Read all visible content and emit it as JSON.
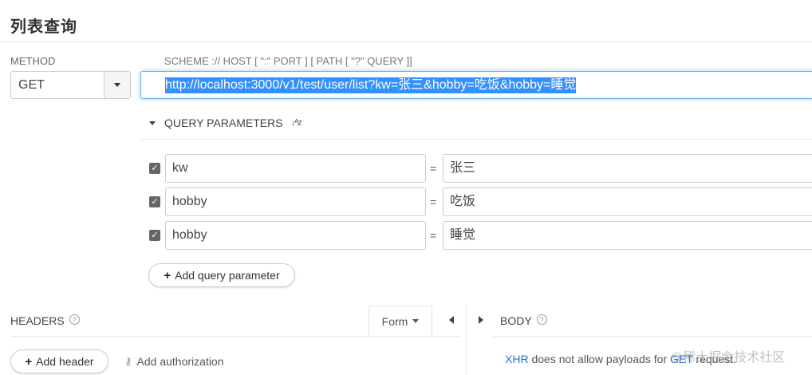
{
  "page": {
    "title": "列表查询"
  },
  "request": {
    "method_label": "METHOD",
    "method_value": "GET",
    "scheme_hint": "SCHEME :// HOST [ \":\" PORT ] [ PATH [ \"?\" QUERY ]]",
    "url": "http://localhost:3000/v1/test/user/list?kw=张三&hobby=吃饭&hobby=睡觉"
  },
  "query": {
    "section_label": "QUERY PARAMETERS",
    "sort_icon_text": "↓ᴬz",
    "params": [
      {
        "enabled": true,
        "key": "kw",
        "value": "张三"
      },
      {
        "enabled": true,
        "key": "hobby",
        "value": "吃饭"
      },
      {
        "enabled": true,
        "key": "hobby",
        "value": "睡觉"
      }
    ],
    "equals": "=",
    "add_label": "Add query parameter"
  },
  "headers": {
    "label": "HEADERS",
    "form_label": "Form",
    "add_label": "Add header",
    "auth_label": "Add authorization"
  },
  "body": {
    "label": "BODY",
    "note_prefix": "XHR",
    "note_middle": " does not allow payloads for ",
    "note_method": "GET",
    "note_suffix": " request."
  },
  "icons": {
    "help": "?",
    "check": "✓",
    "plus": "+",
    "key": "⚷"
  },
  "watermark": "@稀土掘金技术社区",
  "colors": {
    "accent": "#66afe9",
    "selection": "#3390ff",
    "link": "#2a6fd3"
  }
}
